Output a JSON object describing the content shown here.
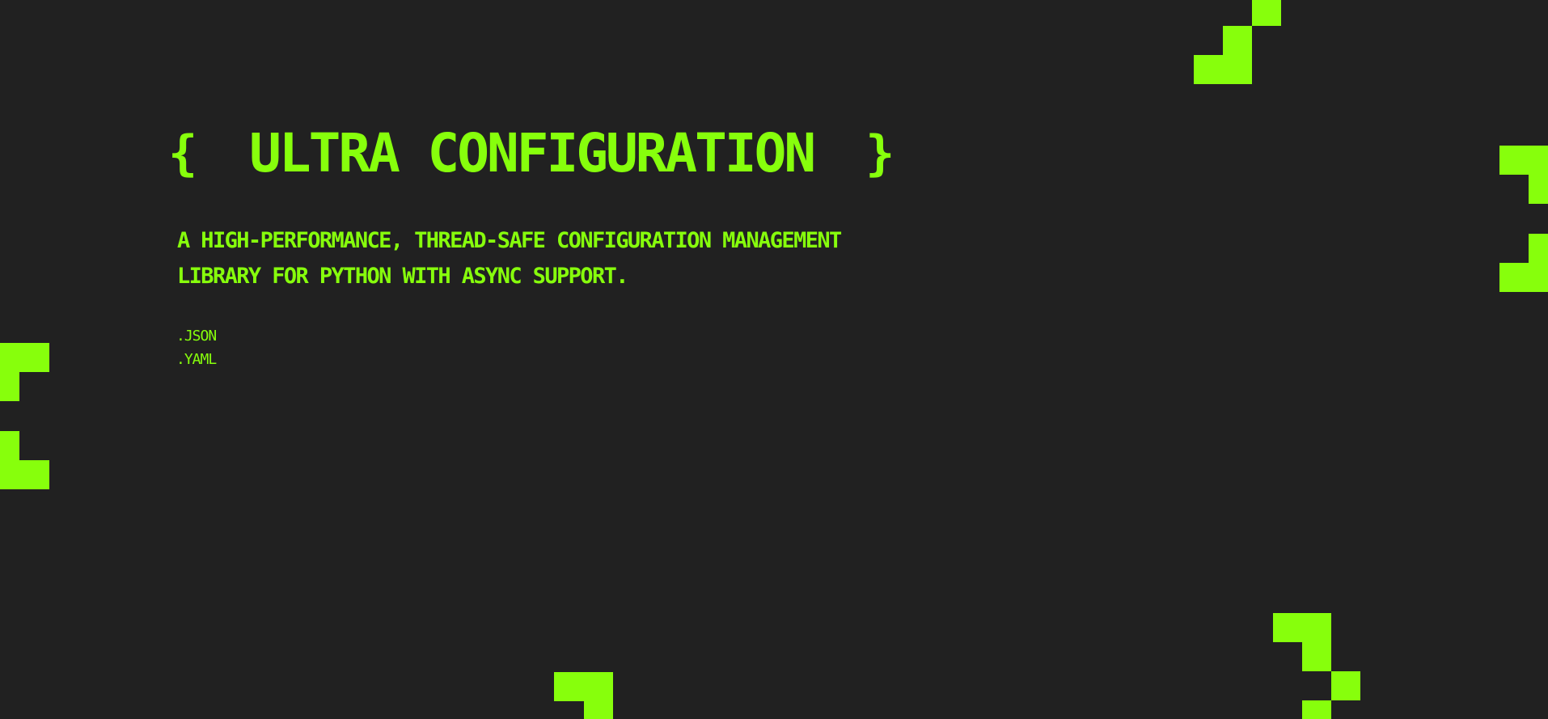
{
  "accent_color": "#87ff0c",
  "background_color": "#212121",
  "hero": {
    "brace_open": "{",
    "title": "ULTRA CONFIGURATION",
    "brace_close": "}",
    "description": "A HIGH-PERFORMANCE, THREAD-SAFE CONFIGURATION MANAGEMENT LIBRARY FOR PYTHON WITH ASYNC SUPPORT.",
    "formats": [
      ".JSON",
      ".YAML"
    ]
  },
  "decorations": {
    "icon": "pixel-bracket-icon",
    "count": 6
  }
}
